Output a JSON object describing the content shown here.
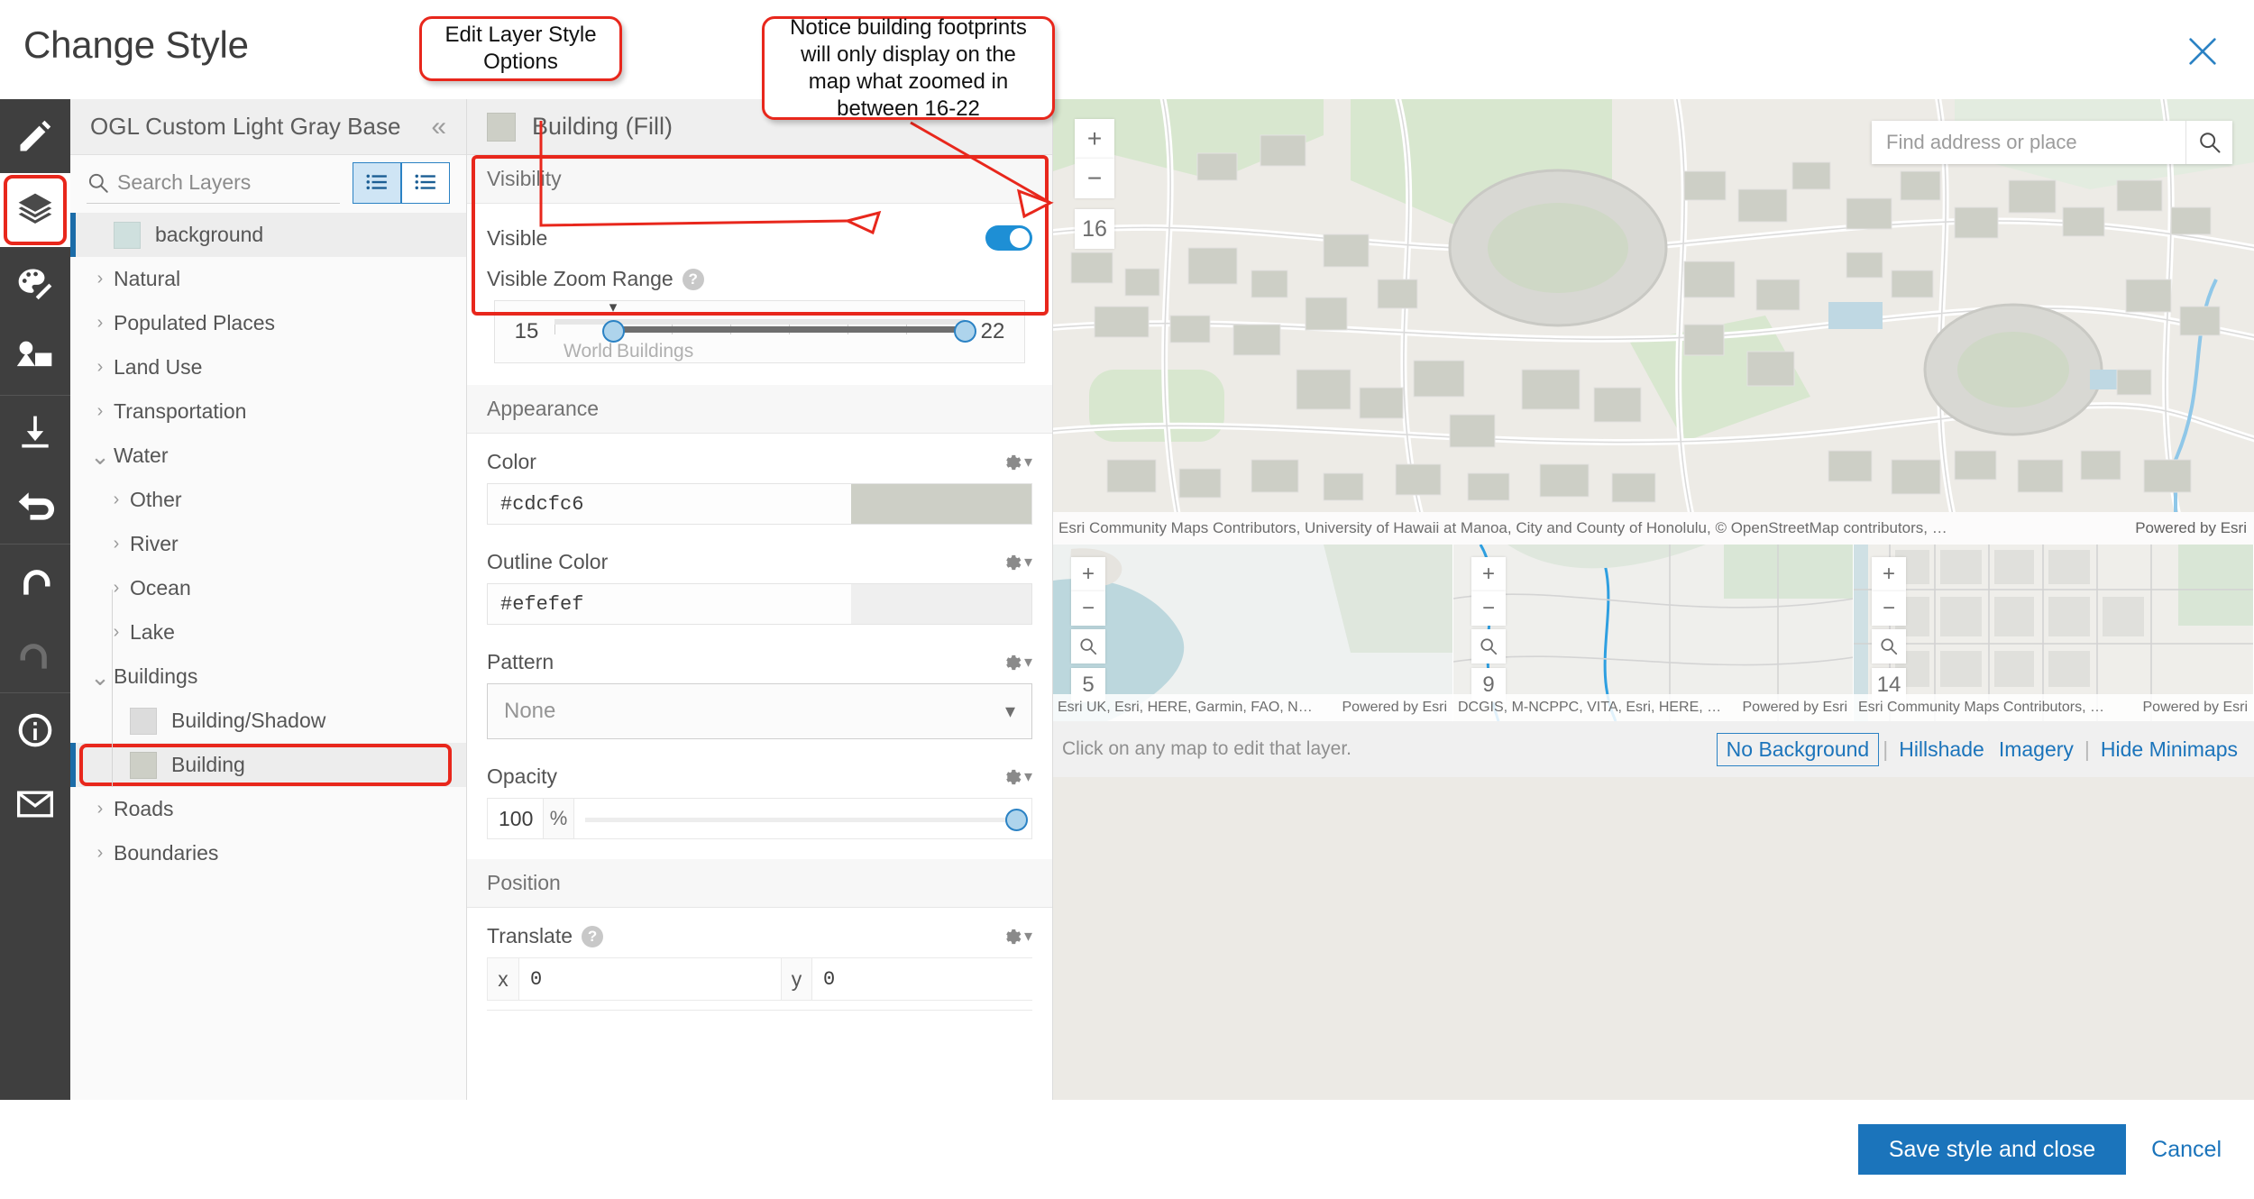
{
  "header": {
    "title": "Change Style",
    "close_icon": "close-icon"
  },
  "callouts": [
    {
      "id": "edit-layer-style-options",
      "text": "Edit Layer Style Options"
    },
    {
      "id": "zoom-note",
      "text": "Notice building footprints will only display on the map what zoomed in between 16-22"
    }
  ],
  "rail": {
    "items": [
      {
        "name": "edit-tool",
        "icon": "pencil-icon",
        "active": false
      },
      {
        "name": "layers-tool",
        "icon": "layers-icon",
        "active": true
      },
      {
        "name": "palette-tool",
        "icon": "palette-icon",
        "active": false
      },
      {
        "name": "sprites-tool",
        "icon": "image-shapes-icon",
        "active": false
      },
      {
        "name": "download-tool",
        "icon": "download-icon",
        "active": false
      },
      {
        "name": "revert-tool",
        "icon": "undo-arrow-icon",
        "active": false
      },
      {
        "name": "undo-tool",
        "icon": "undo-icon",
        "active": false
      },
      {
        "name": "redo-tool",
        "icon": "redo-icon",
        "active": false
      },
      {
        "name": "info-tool",
        "icon": "info-icon",
        "active": false
      },
      {
        "name": "contact-tool",
        "icon": "envelope-icon",
        "active": false
      }
    ]
  },
  "layer_panel": {
    "style_name": "OGL Custom Light Gray Base",
    "collapse_icon": "double-chevron-left-icon",
    "search": {
      "placeholder": "Search Layers",
      "value": "",
      "icon": "search-icon"
    },
    "view_toggle": [
      {
        "name": "list-view-compact",
        "icon": "list-icon",
        "active": true
      },
      {
        "name": "list-view-detailed",
        "icon": "list-icon",
        "active": false
      }
    ],
    "tree": [
      {
        "label": "background",
        "type": "leaf",
        "depth": 0,
        "swatch": "#cfe0de",
        "selected": true,
        "highlight": false
      },
      {
        "label": "Natural",
        "type": "group",
        "depth": 0,
        "expanded": false
      },
      {
        "label": "Populated Places",
        "type": "group",
        "depth": 0,
        "expanded": false
      },
      {
        "label": "Land Use",
        "type": "group",
        "depth": 0,
        "expanded": false
      },
      {
        "label": "Transportation",
        "type": "group",
        "depth": 0,
        "expanded": false
      },
      {
        "label": "Water",
        "type": "group",
        "depth": 0,
        "expanded": true
      },
      {
        "label": "Other",
        "type": "group",
        "depth": 1,
        "expanded": false
      },
      {
        "label": "River",
        "type": "group",
        "depth": 1,
        "expanded": false
      },
      {
        "label": "Ocean",
        "type": "group",
        "depth": 1,
        "expanded": false
      },
      {
        "label": "Lake",
        "type": "group",
        "depth": 1,
        "expanded": false
      },
      {
        "label": "Buildings",
        "type": "group",
        "depth": 0,
        "expanded": true
      },
      {
        "label": "Building/Shadow",
        "type": "leaf",
        "depth": 1,
        "swatch": "#dcdcdc",
        "selected": false,
        "highlight": false
      },
      {
        "label": "Building",
        "type": "leaf",
        "depth": 1,
        "swatch": "#cdcfc6",
        "selected": true,
        "highlight": true
      },
      {
        "label": "Roads",
        "type": "group",
        "depth": 0,
        "expanded": false
      },
      {
        "label": "Boundaries",
        "type": "group",
        "depth": 0,
        "expanded": false
      }
    ]
  },
  "style_panel": {
    "layer_title": "Building (Fill)",
    "layer_swatch": "#cdcfc6",
    "sections": {
      "visibility": {
        "heading": "Visibility",
        "visible_label": "Visible",
        "visible_on": true,
        "zoom_range_label": "Visible Zoom Range",
        "zoom_min_scale": "15",
        "zoom_max_scale": "22",
        "zoom_low_value": 16,
        "zoom_high_value": 22,
        "tick_left_label": "World",
        "tick_right_label": "Buildings"
      },
      "appearance": {
        "heading": "Appearance",
        "color_label": "Color",
        "color_value": "#cdcfc6",
        "outline_color_label": "Outline Color",
        "outline_color_value": "#efefef",
        "pattern_label": "Pattern",
        "pattern_value": "None",
        "opacity_label": "Opacity",
        "opacity_value": "100",
        "opacity_unit": "%"
      },
      "position": {
        "heading": "Position",
        "translate_label": "Translate",
        "translate_x_key": "x",
        "translate_x_value": "0",
        "translate_y_key": "y",
        "translate_y_value": "0"
      }
    }
  },
  "map": {
    "search": {
      "placeholder": "Find address or place",
      "value": "",
      "icon": "search-icon"
    },
    "zoom_in_label": "+",
    "zoom_out_label": "−",
    "zoom_level": "16",
    "attribution": "Esri Community Maps Contributors, University of Hawaii at Manoa, City and County of Honolulu, © OpenStreetMap contributors, …",
    "powered_by": "Powered by Esri",
    "minimaps": [
      {
        "zoom_level": "5",
        "attribution": "Esri UK, Esri, HERE, Garmin, FAO, N…",
        "powered_by": "Powered by Esri"
      },
      {
        "zoom_level": "9",
        "attribution": "DCGIS, M-NCPPC, VITA, Esri, HERE, …",
        "powered_by": "Powered by Esri"
      },
      {
        "zoom_level": "14",
        "attribution": "Esri Community Maps Contributors, …",
        "powered_by": "Powered by Esri"
      }
    ],
    "bottom_bar": {
      "hint": "Click on any map to edit that layer.",
      "options": [
        {
          "label": "No Background",
          "selected": true
        },
        {
          "label": "Hillshade",
          "selected": false
        },
        {
          "label": "Imagery",
          "selected": false
        },
        {
          "label": "Hide Minimaps",
          "selected": false
        }
      ]
    }
  },
  "footer": {
    "save_label": "Save style and close",
    "cancel_label": "Cancel"
  },
  "colors": {
    "accent_blue": "#1b74bb",
    "highlight_red": "#e8271c",
    "rail_dark": "#3f3f3f"
  }
}
